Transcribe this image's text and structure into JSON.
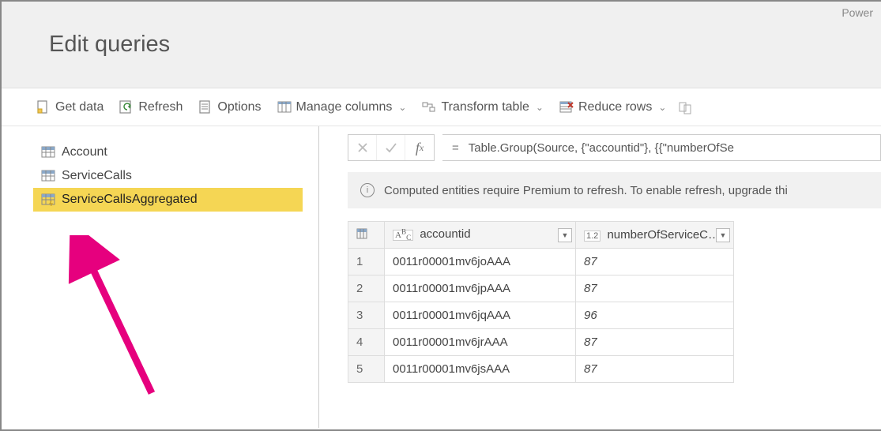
{
  "header": {
    "title": "Edit queries",
    "app_label": "Power"
  },
  "toolbar": {
    "get_data": "Get data",
    "refresh": "Refresh",
    "options": "Options",
    "manage_columns": "Manage columns",
    "transform_table": "Transform table",
    "reduce_rows": "Reduce rows"
  },
  "sidebar": {
    "queries": [
      {
        "name": "Account",
        "selected": false,
        "computed": false
      },
      {
        "name": "ServiceCalls",
        "selected": false,
        "computed": false
      },
      {
        "name": "ServiceCallsAggregated",
        "selected": true,
        "computed": true
      }
    ]
  },
  "formula": {
    "expression": "Table.Group(Source, {\"accountid\"}, {{\"numberOfSe"
  },
  "info_banner": {
    "text": "Computed entities require Premium to refresh. To enable refresh, upgrade thi"
  },
  "table": {
    "columns": [
      {
        "type_label": "ABC",
        "name": "accountid"
      },
      {
        "type_label": "1.2",
        "name": "numberOfServiceC…"
      }
    ],
    "rows": [
      {
        "idx": "1",
        "accountid": "0011r00001mv6joAAA",
        "num": "87"
      },
      {
        "idx": "2",
        "accountid": "0011r00001mv6jpAAA",
        "num": "87"
      },
      {
        "idx": "3",
        "accountid": "0011r00001mv6jqAAA",
        "num": "96"
      },
      {
        "idx": "4",
        "accountid": "0011r00001mv6jrAAA",
        "num": "87"
      },
      {
        "idx": "5",
        "accountid": "0011r00001mv6jsAAA",
        "num": "87"
      }
    ]
  }
}
